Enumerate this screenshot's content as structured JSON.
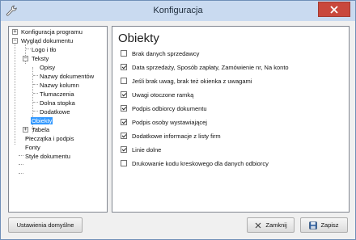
{
  "window": {
    "title": "Konfiguracja"
  },
  "tree": {
    "items": [
      {
        "label": "Konfiguracja programu",
        "expander": "+"
      },
      {
        "label": "Wygląd dokumentu",
        "expander": "−"
      },
      {
        "label": "Logo i tło"
      },
      {
        "label": "Teksty",
        "expander": "−"
      },
      {
        "label": "Opisy"
      },
      {
        "label": "Nazwy dokumentów"
      },
      {
        "label": "Nazwy kolumn"
      },
      {
        "label": "Tłumaczenia"
      },
      {
        "label": "Dolna stopka"
      },
      {
        "label": "Dodatkowe"
      },
      {
        "label": "Obiekty",
        "selected": true
      },
      {
        "label": "Tabela",
        "expander": "+"
      },
      {
        "label": "Pieczątka i podpis"
      },
      {
        "label": "Fonty"
      },
      {
        "label": "Style dokumentu"
      }
    ]
  },
  "panel": {
    "title": "Obiekty",
    "options": [
      {
        "label": "Brak danych sprzedawcy",
        "checked": false
      },
      {
        "label": "Data sprzedaży,  Sposób zapłaty, Zamówienie nr, Na konto",
        "checked": true
      },
      {
        "label": "Jeśli brak uwag, brak też okienka z uwagami",
        "checked": false
      },
      {
        "label": "Uwagi otoczone ramką",
        "checked": true
      },
      {
        "label": "Podpis odbiorcy dokumentu",
        "checked": true
      },
      {
        "label": "Podpis osoby wystawiającej",
        "checked": true
      },
      {
        "label": "Dodatkowe informacje z listy firm",
        "checked": true
      },
      {
        "label": "Linie dolne",
        "checked": true
      },
      {
        "label": "Drukowanie kodu kreskowego dla danych odbiorcy",
        "checked": false
      }
    ]
  },
  "buttons": {
    "defaults": "Ustawienia domyślne",
    "close": "Zamknij",
    "save": "Zapisz"
  },
  "colors": {
    "title_bar": "#c9daf0",
    "selection": "#3399ff",
    "close_button": "#c9483c"
  }
}
